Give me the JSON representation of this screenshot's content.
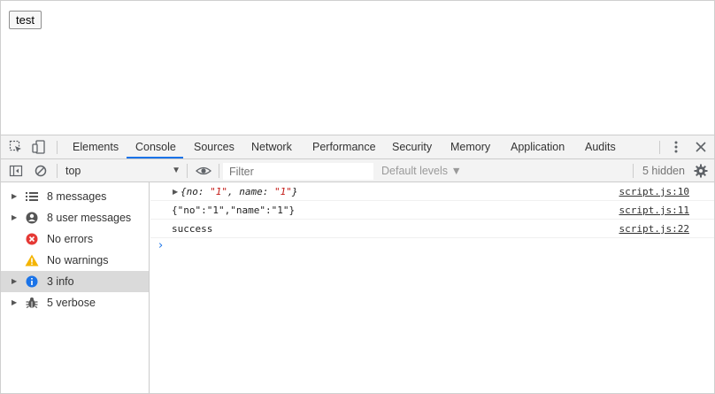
{
  "page": {
    "test_button_label": "test"
  },
  "devtools": {
    "tabs": [
      {
        "label": "Elements"
      },
      {
        "label": "Console"
      },
      {
        "label": "Sources"
      },
      {
        "label": "Network"
      },
      {
        "label": "Performance"
      },
      {
        "label": "Security"
      },
      {
        "label": "Memory"
      },
      {
        "label": "Application"
      },
      {
        "label": "Audits"
      }
    ],
    "active_tab": "Console",
    "accent_color": "#1a73e8",
    "toolbar": {
      "context": "top",
      "filter_placeholder": "Filter",
      "levels_label": "Default levels ▼",
      "hidden_count": "5 hidden"
    },
    "sidebar": {
      "items": [
        {
          "label": "8 messages",
          "icon": "list-icon"
        },
        {
          "label": "8 user messages",
          "icon": "user-icon"
        },
        {
          "label": "No errors",
          "icon": "error-icon"
        },
        {
          "label": "No warnings",
          "icon": "warning-icon"
        },
        {
          "label": "3 info",
          "icon": "info-icon"
        },
        {
          "label": "5 verbose",
          "icon": "bug-icon"
        }
      ],
      "selected": "3 info"
    },
    "console": {
      "messages": [
        {
          "text_prefix": "{no: ",
          "no_val": "\"1\"",
          "mid": ", name: ",
          "name_val": "\"1\"",
          "suffix": "}",
          "source": "script.js:10"
        },
        {
          "text": "{\"no\":\"1\",\"name\":\"1\"}",
          "source": "script.js:11"
        },
        {
          "text": "success",
          "source": "script.js:22"
        }
      ],
      "prompt": "›"
    }
  }
}
